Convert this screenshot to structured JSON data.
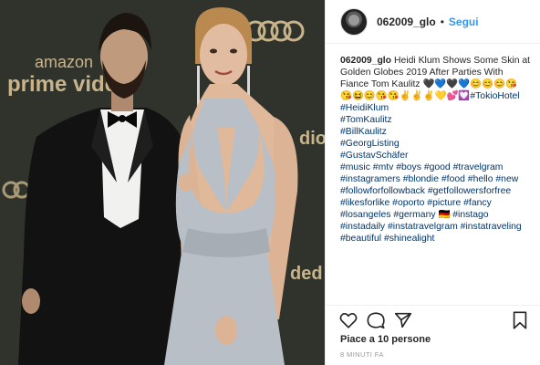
{
  "post": {
    "photo_alt": "Photo of Tom Kaulitz and Heidi Klum at the Golden Globes 2019 after party",
    "backdrop_text": {
      "amazon": "amazon",
      "prime_video": "prime vide",
      "audi": "Audi",
      "side_tags": [
        "dio",
        "ded"
      ]
    }
  },
  "header": {
    "username": "062009_glo",
    "separator": "•",
    "follow_label": "Segui"
  },
  "caption": {
    "username": "062009_glo",
    "text": "Heidi Klum Shows Some Skin at Golden Globes 2019 After Parties With Fiance Tom Kaulitz",
    "emoji_line_1": "🖤💙🖤💙😊😊😊😘",
    "emoji_line_2": "😘😆😊😘😘✌✌✌💛💕💟",
    "first_tag": "#TokioHotel",
    "hashtag_lines": [
      "#HeidiKlum",
      "#TomKaulitz",
      "#BillKaulitz",
      "#GeorgListing",
      "#GustavSchäfer",
      "#music #mtv #boys #good #travelgram",
      "#instagramers #blondie #food #hello #new",
      "#followforfollowback #getfollowersforfree",
      "#likesforlike #oporto #picture #fancy",
      "#losangeles #germany 🇩🇪 #instago",
      "#instadaily #instatravelgram #instatraveling",
      "#beautiful #shinealight"
    ]
  },
  "actions": {
    "like_icon": "heart-icon",
    "comment_icon": "comment-icon",
    "share_icon": "share-icon",
    "save_icon": "bookmark-icon"
  },
  "likes_text": "Piace a 10 persone",
  "timestamp": "8 MINUTI FA",
  "colors": {
    "link_blue": "#3897f0",
    "hashtag": "#003569",
    "text": "#262626",
    "muted": "#999999"
  }
}
